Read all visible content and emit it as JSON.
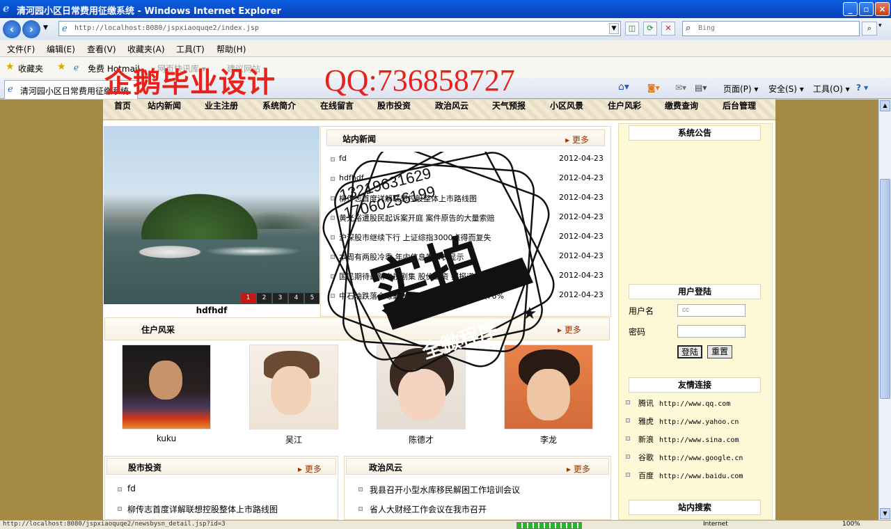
{
  "window": {
    "title": "清河园小区日常费用征缴系统 - Windows Internet Explorer",
    "controls": [
      "_",
      "▫",
      "×"
    ]
  },
  "address": {
    "url": "http://localhost:8080/jspxiaoquqe2/index.jsp",
    "search_placeholder": "Bing"
  },
  "menubar": [
    "文件(F)",
    "编辑(E)",
    "查看(V)",
    "收藏夹(A)",
    "工具(T)",
    "帮助(H)"
  ],
  "favbar": {
    "favorites": "收藏夹",
    "items": [
      "免费 Hotmail",
      "网页快讯库 ▾",
      "建议网站 ▾"
    ]
  },
  "tab": {
    "label": "清河园小区日常费用征缴系统"
  },
  "commandbar": {
    "page": "页面(P) ▾",
    "safety": "安全(S) ▾",
    "tools": "工具(O) ▾",
    "help": "? ▾"
  },
  "watermark": {
    "left": "企鹅毕业设计",
    "right": "QQ:736858727"
  },
  "site": {
    "nav": [
      "首页",
      "站内新闻",
      "业主注册",
      "系统简介",
      "在线留言",
      "股市投资",
      "政治风云",
      "天气预报",
      "小区风景",
      "住户风彩",
      "缴费查询",
      "后台管理"
    ],
    "slideshow": {
      "caption": "hdfhdf",
      "pages": [
        "1",
        "2",
        "3",
        "4",
        "5"
      ]
    },
    "news": {
      "title": "站内新闻",
      "more": "更多",
      "items": [
        {
          "text": "fd",
          "date": "2012-04-23"
        },
        {
          "text": "hdfhdf",
          "date": "2012-04-23"
        },
        {
          "text": "柳传志首度详解联想控股整体上市路线图",
          "date": "2012-04-23"
        },
        {
          "text": "黄光裕遭股民起诉案开庭 案件原告的大量索赔",
          "date": "2012-04-23"
        },
        {
          "text": "沪深股市继续下行 上证综指3000点得而复失",
          "date": "2012-04-23"
        },
        {
          "text": "本周有两股冷季 年内信息发布表显示",
          "date": "2012-04-23"
        },
        {
          "text": "国民期待最新电视剧集 股价工资 据报道",
          "date": "2012-04-23"
        },
        {
          "text": "中石油跌落全球最大市值公司宝座 股价下跌76%",
          "date": "2012-04-23"
        }
      ]
    },
    "residents": {
      "title": "住户风采",
      "more": "更多",
      "people": [
        "kuku",
        "吴江",
        "陈德才",
        "李龙"
      ]
    },
    "stocks": {
      "title": "股市投资",
      "more": "更多",
      "items": [
        "fd",
        "柳传志首度详解联想控股整体上市路线图"
      ]
    },
    "politics": {
      "title": "政治风云",
      "more": "更多",
      "items": [
        "我县召开小型水库移民解困工作培训会议",
        "省人大财经工作会议在我市召开"
      ]
    },
    "announcement": {
      "title": "系统公告"
    },
    "login": {
      "title": "用户登陆",
      "username_label": "用户名",
      "username_value": "cc",
      "password_label": "密码",
      "submit": "登陆",
      "reset": "重置"
    },
    "links": {
      "title": "友情连接",
      "items": [
        {
          "name": "腾讯",
          "url": "http://www.qq.com"
        },
        {
          "name": "雅虎",
          "url": "http://www.yahoo.cn"
        },
        {
          "name": "新浪",
          "url": "http://www.sina.com"
        },
        {
          "name": "谷歌",
          "url": "http://www.google.cn"
        },
        {
          "name": "百度",
          "url": "http://www.baidu.com"
        }
      ]
    },
    "sitesearch": {
      "title": "站内搜索"
    }
  },
  "stamp": {
    "phone1": "13219631629",
    "phone2": "17060256199",
    "big": "实拍",
    "banner": "全微程序"
  },
  "status": {
    "text": "http://localhost:8080/jspxiaoquqe2/newsbysn_detail.jsp?id=3",
    "zone": "Internet",
    "zoom": "100%"
  },
  "colors": {
    "title_blue": "#0a5fe0",
    "page_frame": "#a48a45",
    "watermark_red": "#e8211a",
    "more_link": "#993300"
  }
}
